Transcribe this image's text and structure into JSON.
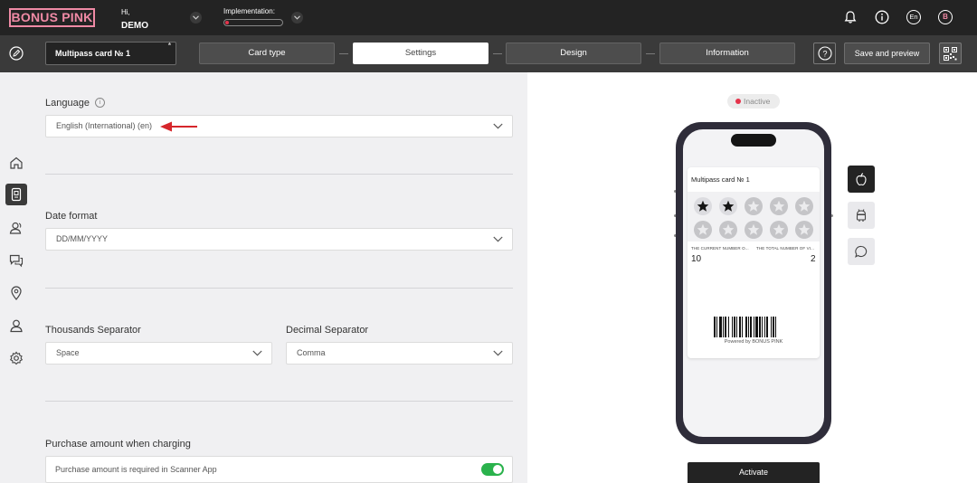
{
  "brand": {
    "logo_text": "BONUS PINK",
    "accent_color": "#ef8aa5"
  },
  "header": {
    "greeting": "Hi,",
    "user_name": "DEMO",
    "implementation_label": "Implementation:",
    "implementation_progress": 0.06,
    "language_badge": "En",
    "user_initial": "B",
    "icons": [
      "bell-icon",
      "info-icon",
      "language-icon",
      "user-icon"
    ]
  },
  "toolbar": {
    "card_name": "Multipass card № 1",
    "required_mark": "*",
    "steps": [
      {
        "label": "Card type",
        "active": false
      },
      {
        "label": "Settings",
        "active": true
      },
      {
        "label": "Design",
        "active": false
      },
      {
        "label": "Information",
        "active": false
      }
    ],
    "help_label": "?",
    "save_label": "Save and preview"
  },
  "sidebar": {
    "items": [
      "home-icon",
      "cards-icon",
      "customers-icon",
      "chat-icon",
      "location-icon",
      "profile-icon",
      "settings-icon"
    ],
    "active_index": 1
  },
  "settings": {
    "language": {
      "label": "Language",
      "info": "i",
      "value": "English (International) (en)"
    },
    "date_format": {
      "label": "Date format",
      "value": "DD/MM/YYYY"
    },
    "thousands_separator": {
      "label": "Thousands Separator",
      "value": "Space"
    },
    "decimal_separator": {
      "label": "Decimal Separator",
      "value": "Comma"
    },
    "purchase_amount": {
      "label": "Purchase amount when charging",
      "toggle_label": "Purchase amount is required in Scanner App",
      "enabled": true
    }
  },
  "preview": {
    "status": "Inactive",
    "status_color": "#e5334b",
    "pass_title": "Multipass card № 1",
    "stamps_total": 10,
    "stamps_filled": 2,
    "field1_label": "THE CURRENT NUMBER O...",
    "field1_value": "10",
    "field2_label": "THE TOTAL NUMBER OF VI...",
    "field2_value": "2",
    "powered_by": "Powered by BONUS PINK",
    "platforms": [
      "apple-icon",
      "android-icon",
      "message-icon"
    ],
    "activate_label": "Activate"
  }
}
